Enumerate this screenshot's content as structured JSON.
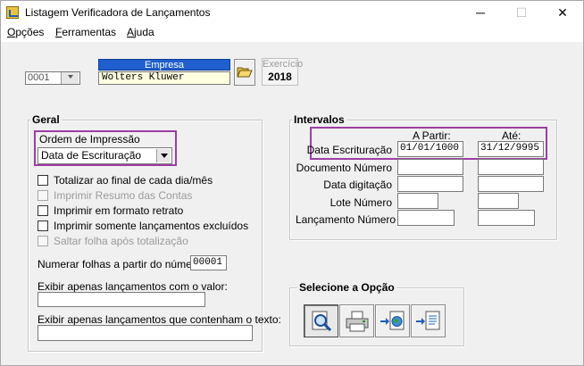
{
  "window": {
    "title": "Listagem Verificadora de Lançamentos",
    "minimize": "─",
    "maximize": "☐",
    "close": "✕"
  },
  "menu": {
    "opcoes": {
      "u": "O",
      "rest": "pções"
    },
    "ferramentas": {
      "u": "F",
      "rest": "erramentas"
    },
    "ajuda": {
      "u": "A",
      "rest": "juda"
    }
  },
  "empresa": {
    "label": "Empresa",
    "code": "0001",
    "name": "Wolters Kluwer",
    "exercicio_label": "Exercício",
    "exercicio_value": "2018"
  },
  "geral": {
    "legend": "Geral",
    "ordem_label": "Ordem de Impressão",
    "ordem_value": "Data de Escrituração",
    "checkboxes": [
      {
        "label": "Totalizar ao final de cada dia/mês",
        "enabled": true,
        "checked": false
      },
      {
        "label": "Imprimir Resumo das Contas",
        "enabled": false,
        "checked": false
      },
      {
        "label": "Imprimir em formato retrato",
        "enabled": true,
        "checked": false
      },
      {
        "label": "Imprimir somente lançamentos excluídos",
        "enabled": true,
        "checked": false
      },
      {
        "label": "Saltar folha após totalização",
        "enabled": false,
        "checked": false
      }
    ],
    "numerar_label": "Numerar folhas a partir do número",
    "numerar_value": "00001",
    "valor_label": "Exibir apenas lançamentos com o valor:",
    "valor_value": "",
    "texto_label": "Exibir apenas lançamentos que contenham o texto:",
    "texto_value": ""
  },
  "intervalos": {
    "legend": "Intervalos",
    "col_from": "A Partir:",
    "col_to": "Até:",
    "rows": [
      {
        "label": "Data Escrituração",
        "from": "01/01/1000",
        "to": "31/12/9995"
      },
      {
        "label": "Documento Número",
        "from": "",
        "to": ""
      },
      {
        "label": "Data digitação",
        "from": "",
        "to": ""
      },
      {
        "label": "Lote Número",
        "from": "",
        "to": ""
      },
      {
        "label": "Lançamento Número",
        "from": "",
        "to": ""
      }
    ]
  },
  "selecione": {
    "legend": "Selecione a Opção",
    "buttons": [
      "preview-icon",
      "printer-icon",
      "export-globe-icon",
      "export-document-icon"
    ]
  },
  "colors": {
    "highlight": "#9c3fa3",
    "empresa_header": "#1f5fcf",
    "name_field": "#ffffe0"
  }
}
